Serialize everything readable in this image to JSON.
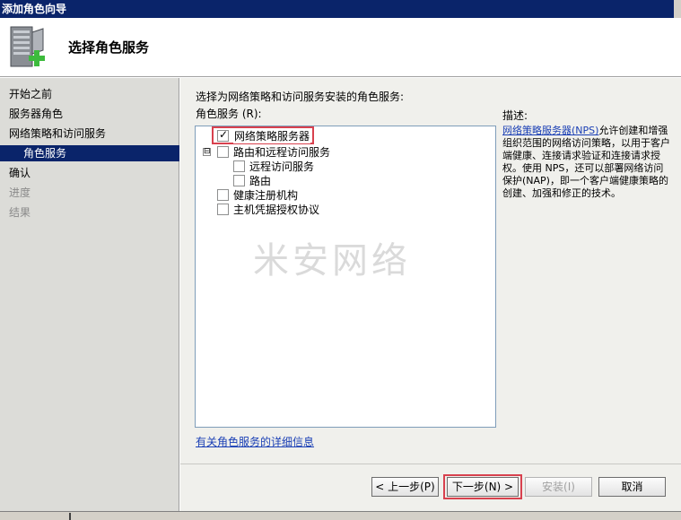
{
  "window": {
    "title": "添加角色向导"
  },
  "header": {
    "title": "选择角色服务",
    "icon": "server-add-icon"
  },
  "nav": {
    "items": [
      {
        "label": "开始之前",
        "state": "normal"
      },
      {
        "label": "服务器角色",
        "state": "normal"
      },
      {
        "label": "网络策略和访问服务",
        "state": "normal"
      },
      {
        "label": "角色服务",
        "state": "selected"
      },
      {
        "label": "确认",
        "state": "normal"
      },
      {
        "label": "进度",
        "state": "disabled"
      },
      {
        "label": "结果",
        "state": "disabled"
      }
    ]
  },
  "main": {
    "prompt": "选择为网络策略和访问服务安装的角色服务:",
    "list_label": "角色服务 (R):",
    "services": [
      {
        "label": "网络策略服务器",
        "checked": true
      },
      {
        "label": "路由和远程访问服务",
        "checked": false,
        "expander": "⊟"
      },
      {
        "label": "远程访问服务",
        "checked": false
      },
      {
        "label": "路由",
        "checked": false
      },
      {
        "label": "健康注册机构",
        "checked": false
      },
      {
        "label": "主机凭据授权协议",
        "checked": false
      }
    ],
    "desc_label": "描述:",
    "desc_link": "网络策略服务器(NPS)",
    "desc_text": "允许创建和增强组织范围的网络访问策略，以用于客户端健康、连接请求验证和连接请求授权。使用 NPS，还可以部署网络访问保护(NAP)，即一个客户端健康策略的创建、加强和修正的技术。",
    "more_link": "有关角色服务的详细信息"
  },
  "buttons": {
    "back": "< 上一步(P)",
    "next": "下一步(N) >",
    "install": "安装(I)",
    "cancel": "取消"
  },
  "watermark": "米安网络",
  "colors": {
    "titlebar": "#0a246a",
    "selected_nav": "#0a246a",
    "highlight": "#d8414e",
    "link": "#1a3fb5"
  }
}
